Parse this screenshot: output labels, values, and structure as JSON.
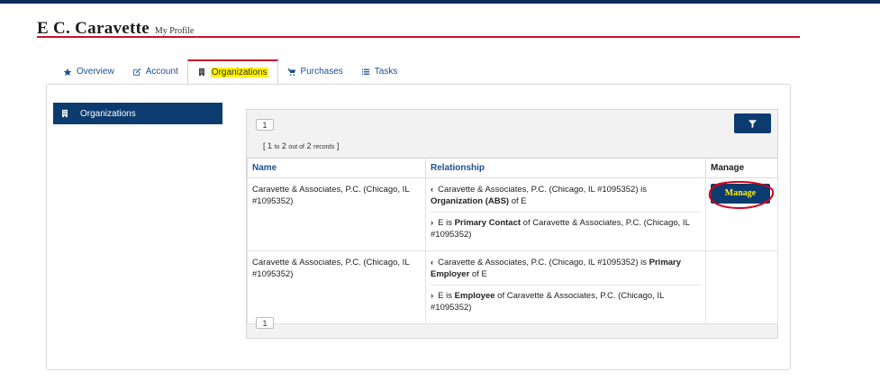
{
  "profile": {
    "name": "E C. Caravette",
    "subtitle": "My Profile"
  },
  "tabs": [
    {
      "label": "Overview",
      "icon": "star-icon"
    },
    {
      "label": "Account",
      "icon": "edit-icon"
    },
    {
      "label": "Organizations",
      "icon": "building-icon",
      "active": true
    },
    {
      "label": "Purchases",
      "icon": "cart-icon"
    },
    {
      "label": "Tasks",
      "icon": "list-icon"
    }
  ],
  "side_nav": {
    "label": "Organizations",
    "icon": "building-icon"
  },
  "grid": {
    "page_top": "1",
    "page_bottom": "1",
    "records": {
      "open": "[ 1",
      "to": "to",
      "to_value": "2",
      "out_of": "out of",
      "total": "2",
      "records": "records",
      "close": "]"
    },
    "columns": {
      "name": "Name",
      "relationship": "Relationship",
      "manage": "Manage"
    },
    "rows": [
      {
        "name": "Caravette & Associates, P.C. (Chicago, IL #1095352)",
        "relationships": [
          {
            "arrow": "‹",
            "pre": "Caravette & Associates, P.C. (Chicago, IL #1095352) is ",
            "bold": "Organization (ABS)",
            "post": " of E"
          },
          {
            "arrow": "›",
            "pre": "E is ",
            "bold": "Primary Contact",
            "post": " of Caravette & Associates, P.C. (Chicago, IL #1095352)"
          }
        ],
        "manage_label": "Manage"
      },
      {
        "name": "Caravette & Associates, P.C. (Chicago, IL #1095352)",
        "relationships": [
          {
            "arrow": "‹",
            "pre": "Caravette & Associates, P.C. (Chicago, IL #1095352) is ",
            "bold": "Primary Employer",
            "post": " of E"
          },
          {
            "arrow": "›",
            "pre": "E is ",
            "bold": "Employee",
            "post": " of Caravette & Associates, P.C. (Chicago, IL #1095352)"
          }
        ],
        "manage_label": ""
      }
    ]
  },
  "colors": {
    "brand_navy": "#0b3b6f",
    "accent_red": "#c8102e",
    "highlight": "#fff200",
    "link_blue": "#1d4f91"
  }
}
